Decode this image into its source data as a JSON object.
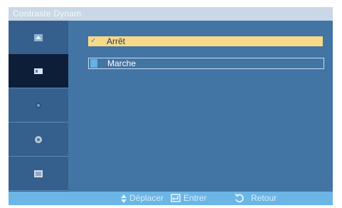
{
  "window": {
    "title": "Contraste Dynam."
  },
  "sidebar": {
    "items": [
      {
        "icon": "picture-icon"
      },
      {
        "icon": "sound-icon",
        "selected": true
      },
      {
        "icon": "setup-icon"
      },
      {
        "icon": "multi-control-icon"
      },
      {
        "icon": "source-icon"
      }
    ]
  },
  "options": [
    {
      "label": "Arrêt",
      "selected": true
    },
    {
      "label": "Marche",
      "selected": false
    }
  ],
  "footer": {
    "move": "Déplacer",
    "enter": "Entrer",
    "return": "Retour"
  },
  "colors": {
    "accent": "#f8d989",
    "background": "#4274a4",
    "sidebar": "#355f8c",
    "title_bar": "#c9d7e6",
    "footer": "#6cb6e6"
  }
}
